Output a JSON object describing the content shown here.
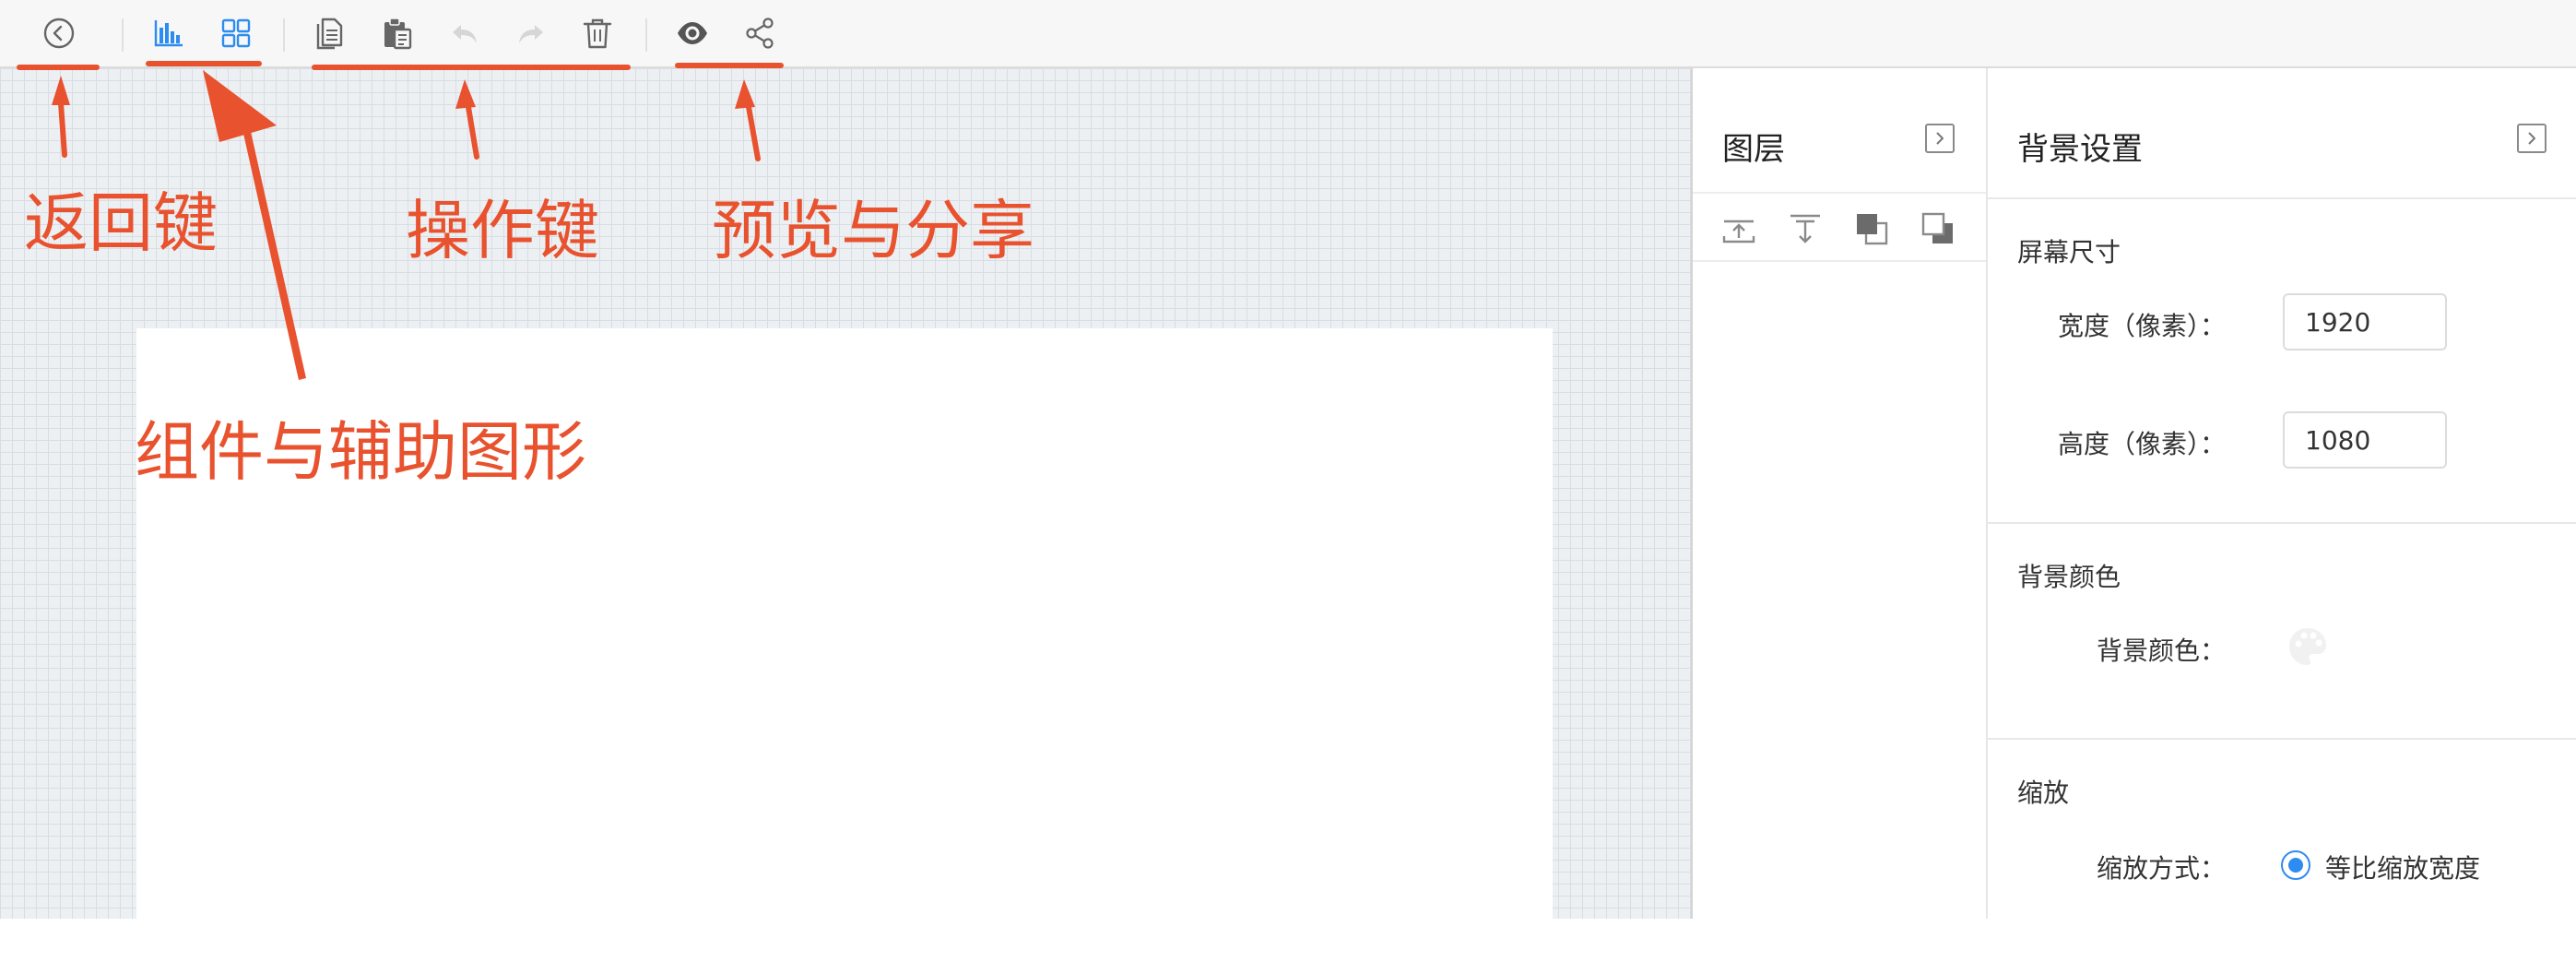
{
  "toolbar": {
    "buttons": [
      {
        "name": "back-button",
        "icon": "back-circle-icon"
      },
      {
        "name": "components-button",
        "icon": "bar-chart-icon"
      },
      {
        "name": "grid-button",
        "icon": "grid-icon"
      },
      {
        "name": "copy-button",
        "icon": "copy-icon"
      },
      {
        "name": "paste-button",
        "icon": "paste-icon"
      },
      {
        "name": "undo-button",
        "icon": "undo-icon"
      },
      {
        "name": "redo-button",
        "icon": "redo-icon"
      },
      {
        "name": "delete-button",
        "icon": "trash-icon"
      },
      {
        "name": "preview-button",
        "icon": "eye-icon"
      },
      {
        "name": "share-button",
        "icon": "share-icon"
      }
    ]
  },
  "layers": {
    "title": "图层",
    "tools": [
      "move-up-icon",
      "move-down-icon",
      "bring-to-front-icon",
      "send-to-back-icon"
    ]
  },
  "settings": {
    "title": "背景设置",
    "screen_size": {
      "title": "屏幕尺寸",
      "width_label": "宽度（像素）：",
      "width_value": "1920",
      "height_label": "高度（像素）：",
      "height_value": "1080"
    },
    "background_color": {
      "title": "背景颜色",
      "label": "背景颜色："
    },
    "zoom": {
      "title": "缩放",
      "mode_label": "缩放方式：",
      "mode_option": "等比缩放宽度"
    }
  },
  "annotations": {
    "back": "返回键",
    "operations": "操作键",
    "preview_share": "预览与分享",
    "components": "组件与辅助图形"
  },
  "colors": {
    "accent_blue": "#2d8cf0",
    "annotation_red": "#e8522e",
    "canvas_bg": "#edf0f3"
  }
}
